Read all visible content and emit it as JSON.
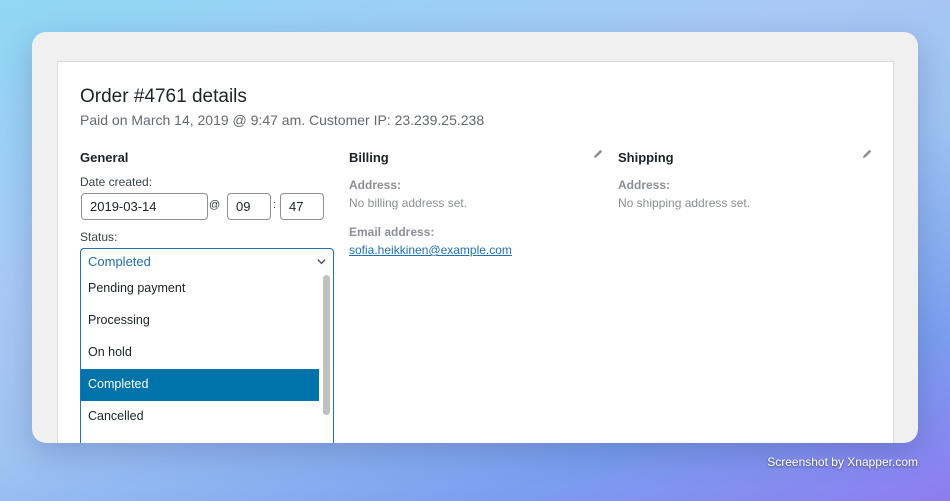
{
  "order": {
    "title": "Order #4761 details",
    "subtitle": "Paid on March 14, 2019 @ 9:47 am. Customer IP: 23.239.25.238"
  },
  "general": {
    "heading": "General",
    "date_label": "Date created:",
    "date_value": "2019-03-14",
    "at_symbol": "@",
    "hour_value": "09",
    "time_colon": ":",
    "minute_value": "47",
    "status_label": "Status:",
    "status_value": "Completed",
    "status_options": [
      "Pending payment",
      "Processing",
      "On hold",
      "Completed",
      "Cancelled"
    ]
  },
  "billing": {
    "heading": "Billing",
    "address_label": "Address:",
    "address_value": "No billing address set.",
    "email_label": "Email address:",
    "email_value": "sofia.heikkinen@example.com"
  },
  "shipping": {
    "heading": "Shipping",
    "address_label": "Address:",
    "address_value": "No shipping address set."
  },
  "credit": "Screenshot by Xnapper.com",
  "colors": {
    "accent": "#2271b1",
    "selected": "#0073aa"
  }
}
